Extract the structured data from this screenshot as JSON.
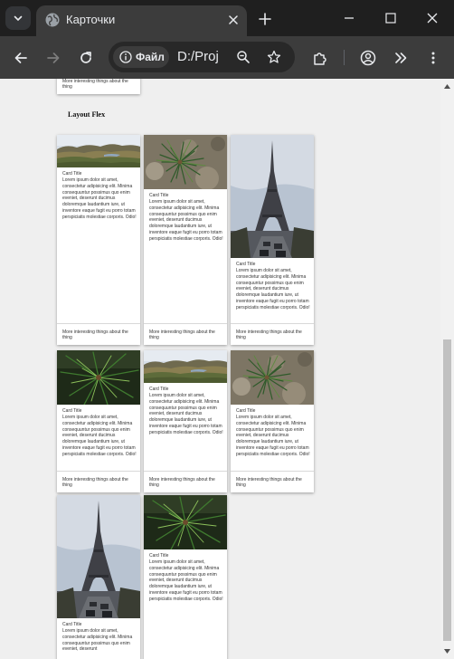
{
  "browser": {
    "tab_title": "Карточки",
    "site_chip_label": "Файл",
    "url": "D:/Proj",
    "colors": {
      "chrome_dark": "#1f1f1f",
      "toolbar": "#3c3c3c",
      "page_bg": "#efefef"
    }
  },
  "page": {
    "top_card_footer": "More interesting things about the thing",
    "section_heading": "Layout Flex",
    "cards": [
      {
        "image": "landscape",
        "title": "Card Title",
        "text": "Lorem ipsum dolor sit amet, consectetur adipisicing elit. Minima consequuntur possimus quo enim eveniet, deserunt ducimus doloremque laudantium iure, ut inventore eaque fugit eu porro totam perspiciatis molestiae corporis. Odio!",
        "footer": "More interesting things about the thing"
      },
      {
        "image": "pine-ground",
        "title": "Card Title",
        "text": "Lorem ipsum dolor sit amet, consectetur adipisicing elit. Minima consequuntur possimus quo enim eveniet, deserunt ducimus doloremque laudantium iure, ut inventore eaque fugit eu porro totam perspiciatis molestiae corporis. Odio!",
        "footer": "More interesting things about the thing"
      },
      {
        "image": "eiffel",
        "title": "Card Title",
        "text": "Lorem ipsum dolor sit amet, consectetur adipisicing elit. Minima consequuntur possimus quo enim eveniet, deserunt ducimus doloremque laudantium iure, ut inventore eaque fugit eu porro totam perspiciatis molestiae corporis. Odio!",
        "footer": "More interesting things about the thing"
      },
      {
        "image": "pine-branch",
        "title": "Card Title",
        "text": "Lorem ipsum dolor sit amet, consectetur adipisicing elit. Minima consequuntur possimus quo enim eveniet, deserunt ducimus doloremque laudantium iure, ut inventore eaque fugit eu porro totam perspiciatis molestiae corporis. Odio!",
        "footer": "More interesting things about the thing"
      },
      {
        "image": "landscape",
        "title": "Card Title",
        "text": "Lorem ipsum dolor sit amet, consectetur adipisicing elit. Minima consequuntur possimus quo enim eveniet, deserunt ducimus doloremque laudantium iure, ut inventore eaque fugit eu porro totam perspiciatis molestiae corporis. Odio!",
        "footer": "More interesting things about the thing"
      },
      {
        "image": "pine-ground",
        "title": "Card Title",
        "text": "Lorem ipsum dolor sit amet, consectetur adipisicing elit. Minima consequuntur possimus quo enim eveniet, deserunt ducimus doloremque laudantium iure, ut inventore eaque fugit eu porro totam perspiciatis molestiae corporis. Odio!",
        "footer": "More interesting things about the thing"
      },
      {
        "image": "eiffel",
        "title": "Card Title",
        "text": "Lorem ipsum dolor sit amet, consectetur adipisicing elit. Minima consequuntur possimus quo enim eveniet, deserunt",
        "footer": ""
      },
      {
        "image": "pine-branch",
        "title": "Card Title",
        "text": "Lorem ipsum dolor sit amet, consectetur adipisicing elit. Minima consequuntur possimus quo enim eveniet, deserunt ducimus doloremque laudantium iure, ut inventore eaque fugit eu porro totam perspiciatis molestiae corporis. Odio!",
        "footer": ""
      }
    ]
  }
}
